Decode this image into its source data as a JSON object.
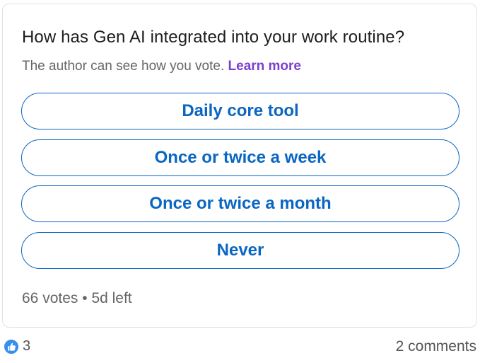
{
  "poll": {
    "question": "How has Gen AI integrated into your work routine?",
    "note": "The author can see how you vote.",
    "learn_more": "Learn more",
    "options": [
      {
        "label": "Daily core tool"
      },
      {
        "label": "Once or twice a week"
      },
      {
        "label": "Once or twice a month"
      },
      {
        "label": "Never"
      }
    ],
    "votes": "66 votes",
    "separator": "•",
    "time_left": "5d left"
  },
  "social": {
    "reaction_icon": "like-icon",
    "reaction_count": "3",
    "comments": "2 comments"
  },
  "colors": {
    "accent": "#0a66c2",
    "learn_more": "#7b3fcf",
    "muted_text": "#666666"
  }
}
